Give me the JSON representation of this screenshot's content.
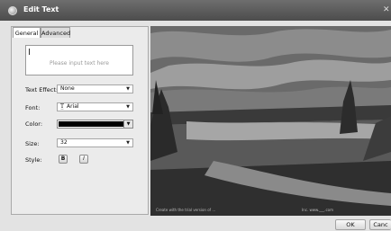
{
  "window": {
    "title": "Edit Text"
  },
  "tabs": [
    {
      "label": "General",
      "active": true
    },
    {
      "label": "Advanced",
      "active": false
    }
  ],
  "text_input": {
    "value": "",
    "placeholder": "Please input text here"
  },
  "fields": {
    "text_effect": {
      "label": "Text Effect:",
      "value": "None"
    },
    "font": {
      "label": "Font:",
      "value": "Arial",
      "icon": "font-glyph-icon"
    },
    "color": {
      "label": "Color:",
      "value": "#000000"
    },
    "size": {
      "label": "Size:",
      "value": "32"
    },
    "style": {
      "label": "Style:",
      "bold_label": "B",
      "italic_label": "I"
    }
  },
  "preview": {
    "watermark": "Create with the trial version of ... ",
    "watermark_right": "Inc. www.___.com"
  },
  "footer": {
    "ok_label": "OK",
    "cancel_label": "Canc"
  }
}
